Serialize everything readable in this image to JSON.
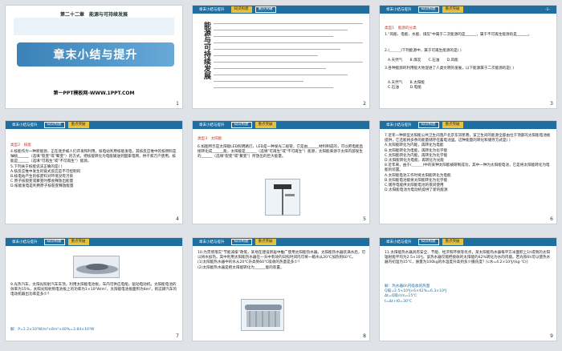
{
  "header": {
    "tag": "章末小结与提升",
    "tab1": "知识构建",
    "tab2": "重点突破"
  },
  "slides": [
    {
      "num": "1",
      "title": "第二十二章　能源与可持续发展",
      "banner": "章末小结与提升",
      "link": "第一PPT模板网-WWW.1PPT.COM"
    },
    {
      "num": "2",
      "vertical": "能源与可持续发展"
    },
    {
      "num": "3",
      "page": "-1-",
      "type": "类型1　能源的分类",
      "q1": "1.\"风能、电能、水能、煤炭\"中属于二次能源的是______，属于不可再生能源的是______。",
      "q2": "2.(＿＿＿)下列能源中，属于可再生能源的是( )",
      "opts1": "A.天然气　　B.煤炭　　C.石油　　D.风能",
      "q3": "3.各种能源的利用极大地促进了人类文明的发展，以下能源属于二次能源的是( )",
      "opts2": "A.天然气　　B.太阳能\nC.石油　　　D.电能"
    },
    {
      "num": "4",
      "type": "类型2　核能",
      "text": "4.核能作为一种新能源，正在逐步被人们开发和利用，核电站利用核能发电，其核反应堆中的核燃料是铀核______（选填\"裂变\"或\"聚变\"）的方式，把核能转化为电能输送到国家电网，供千家万户使用。核能是______（选填\"可再生\"或\"不可再生\"）能源。\n5.下列关于核能说法正确的是( )\nA.核反应堆中发生的链式反应是不可控制的\nB.核电站产生的核废料对环境没有污染\nC.原子核裂变或聚变时都会释放出能量\nD.核能发电是利用原子核裂变释放能量"
    },
    {
      "num": "5",
      "type": "类型3　太阳能",
      "text": "6.如图所示是太阳能LED照明路灯，LED是一种发光二极管，它是由______材料制成的，可以把电能直接转化成______能，太阳能是______（选填\"可再生\"或\"不可再生\"）能源，太阳能来源于太阳内部发生的______（选填\"裂变\"或\"聚变\"）所放出的巨大能量。"
    },
    {
      "num": "6",
      "text": "7.近年一种新型太阳能公共卫生间落户北京东郊民巷，该卫生间的能源全部由位于顶部的太阳能电池板提供，它还能将多余的能量储存在蓄电池里。这种能量的转化和储存方式是( )\nA.太阳能转化为内能，再转化为电能\nB.太阳能转化为电能，再转化为化学能\nC.太阳能转化为内能，再转化为化学能\nD.太阳能转化为电能，再转化为光能\n8.近年来，由于(＿＿＿)中的某种太阳能被研制成功，其中一种为太阳能电池，它是将太阳能转化为电能的装置。\nA.太阳能电池工作时将太阳能转化为电能\nB.太阳能电池能将太阳能转化为化学能\nC.储存电能供太阳能电池的夜间使用\nD.太阳能电池为电动机提供了新的能源"
    },
    {
      "num": "7",
      "text": "9.光热汽车，太阳光照射汽车车顶，利用太阳能电池板，车内可供应电能，驱动电动机。太阳能电池的效率为15%，太阳光照射到电池板上的功率为1×10³W/m²，太阳能电池板面积为8m²，则这辆汽车的电动机输出功率是多少？",
      "ans": "解：P=1.2×10³W/m²×8m²×40%=3.84×10³W"
    },
    {
      "num": "8",
      "text": "10.为贯彻落实\"节能减排\"政策，某地在建设新居中推广使用太阳能热水器。太阳能热水器装满水后，可以将水加热。其中利用太阳能热水器在一天中有效的日照时间内可将一箱水从20℃加热到60℃。\n(1)太阳能热水器中的水从20℃升高到60℃吸收的热量是多少？\n(2)太阳能热水器是把太阳能转化为______能的装置。"
    },
    {
      "num": "9",
      "text": "11.太阳能热水器具有安全、节能、经济和环保等优点，某太阳能热水器每平方米面积上1h得到的太阳辐射能平均为2.5×10⁶J，该热水器仅能把接收的太阳能的42%转化为水的内能。若光照6h可以使热水器内初温为15℃，质量为100kg的水温度升高到多少摄氏度？[c水=4.2×10³J/(kg·℃)]",
      "ans": "解：热水器6h内吸收的热量\nQ吸=2.5×10⁶J×6×42%=6.3×10⁶J\nΔt=Q吸/cm=15℃\nt=Δt+t0=30℃"
    }
  ],
  "colors": {
    "accent": "#1f6ea0",
    "highlight": "#e6c13c",
    "answer": "#c0392b"
  }
}
